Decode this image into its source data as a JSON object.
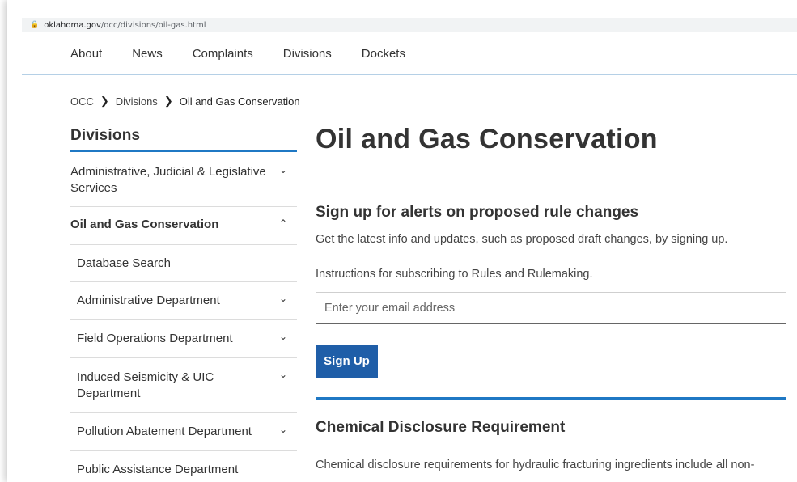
{
  "browser": {
    "url_host": "oklahoma.gov",
    "url_path": "/occ/divisions/oil-gas.html"
  },
  "nav": [
    "About",
    "News",
    "Complaints",
    "Divisions",
    "Dockets"
  ],
  "breadcrumb": [
    "OCC",
    "Divisions",
    "Oil and Gas Conservation"
  ],
  "sidebar": {
    "title": "Divisions",
    "items": [
      {
        "label": "Administrative, Judicial & Legislative Services",
        "chevron": "down"
      },
      {
        "label": "Oil and Gas Conservation",
        "chevron": "up"
      },
      {
        "label": "Database Search",
        "chevron": ""
      },
      {
        "label": "Administrative Department",
        "chevron": "down"
      },
      {
        "label": "Field Operations Department",
        "chevron": "down"
      },
      {
        "label": "Induced Seismicity & UIC Department",
        "chevron": "down"
      },
      {
        "label": "Pollution Abatement Department",
        "chevron": "down"
      },
      {
        "label": "Public Assistance Department",
        "chevron": ""
      }
    ]
  },
  "main": {
    "title": "Oil and Gas Conservation",
    "alerts_heading": "Sign up for alerts on proposed rule changes",
    "alerts_text": "Get the latest info and updates, such as proposed draft changes, by signing up.",
    "instructions_text": "Instructions for subscribing to Rules and Rulemaking.",
    "email_placeholder": "Enter your email address",
    "signup_label": "Sign Up",
    "chem_heading": "Chemical Disclosure Requirement",
    "chem_text": "Chemical disclosure requirements for hydraulic fracturing ingredients include all non-"
  },
  "colors": {
    "accent": "#1f78c4",
    "button": "#1f5ea8"
  }
}
